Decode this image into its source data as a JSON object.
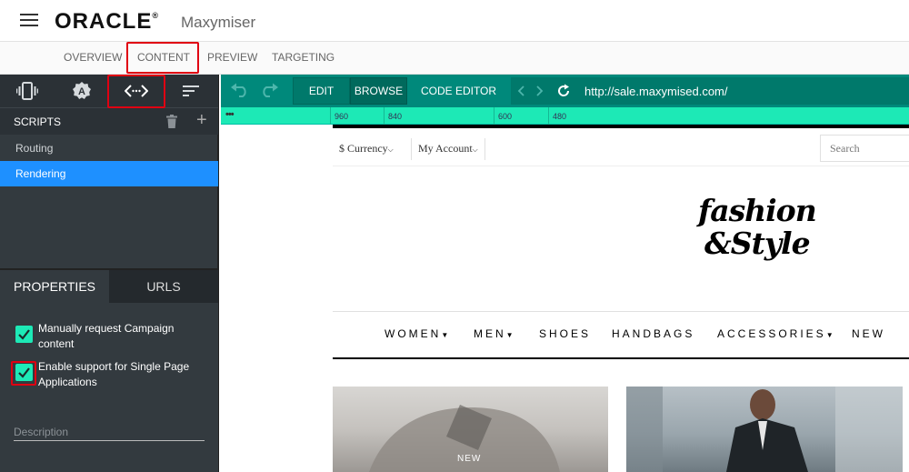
{
  "header": {
    "logo_text": "ORACLE",
    "logo_reg": "®",
    "product": "Maxymiser"
  },
  "main_nav": {
    "tabs": [
      "OVERVIEW",
      "CONTENT",
      "PREVIEW",
      "TARGETING"
    ],
    "highlighted": "CONTENT"
  },
  "left_panel": {
    "icon_tabs": [
      "vibrate-icon",
      "badge-a-icon",
      "code-icon",
      "sort-icon"
    ],
    "scripts": {
      "title": "SCRIPTS",
      "items": [
        {
          "label": "Routing",
          "selected": false
        },
        {
          "label": "Rendering",
          "selected": true
        }
      ]
    },
    "properties": {
      "tabs": [
        "PROPERTIES",
        "URLS"
      ],
      "active_tab": "PROPERTIES",
      "checkboxes": [
        {
          "label": "Manually request Campaign content",
          "checked": true
        },
        {
          "label": "Enable support for Single Page Applications",
          "checked": true
        }
      ],
      "description_placeholder": "Description"
    }
  },
  "editor_toolbar": {
    "buttons": [
      "EDIT",
      "BROWSE",
      "CODE EDITOR"
    ],
    "active": "BROWSE",
    "url": "http://sale.maxymised.com/"
  },
  "ruler": {
    "dots": "•••",
    "marks": [
      "960",
      "840",
      "600",
      "480"
    ]
  },
  "site": {
    "currency": "$ Currency",
    "account": "My Account",
    "search_placeholder": "Search",
    "brand_line1": "fashion",
    "brand_line2": "&Style",
    "menu": [
      {
        "label": "WOMEN",
        "dropdown": true
      },
      {
        "label": "MEN",
        "dropdown": true
      },
      {
        "label": "SHOES",
        "dropdown": false
      },
      {
        "label": "HANDBAGS",
        "dropdown": false
      },
      {
        "label": "ACCESSORIES",
        "dropdown": true
      },
      {
        "label": "NEW",
        "dropdown": false
      }
    ],
    "tile_label": "NEW"
  },
  "colors": {
    "accent_teal": "#00897b",
    "ruler_mint": "#1de9b6",
    "selected_blue": "#1e90ff",
    "panel_dark": "#333a3f",
    "highlight_red": "#e00012"
  }
}
